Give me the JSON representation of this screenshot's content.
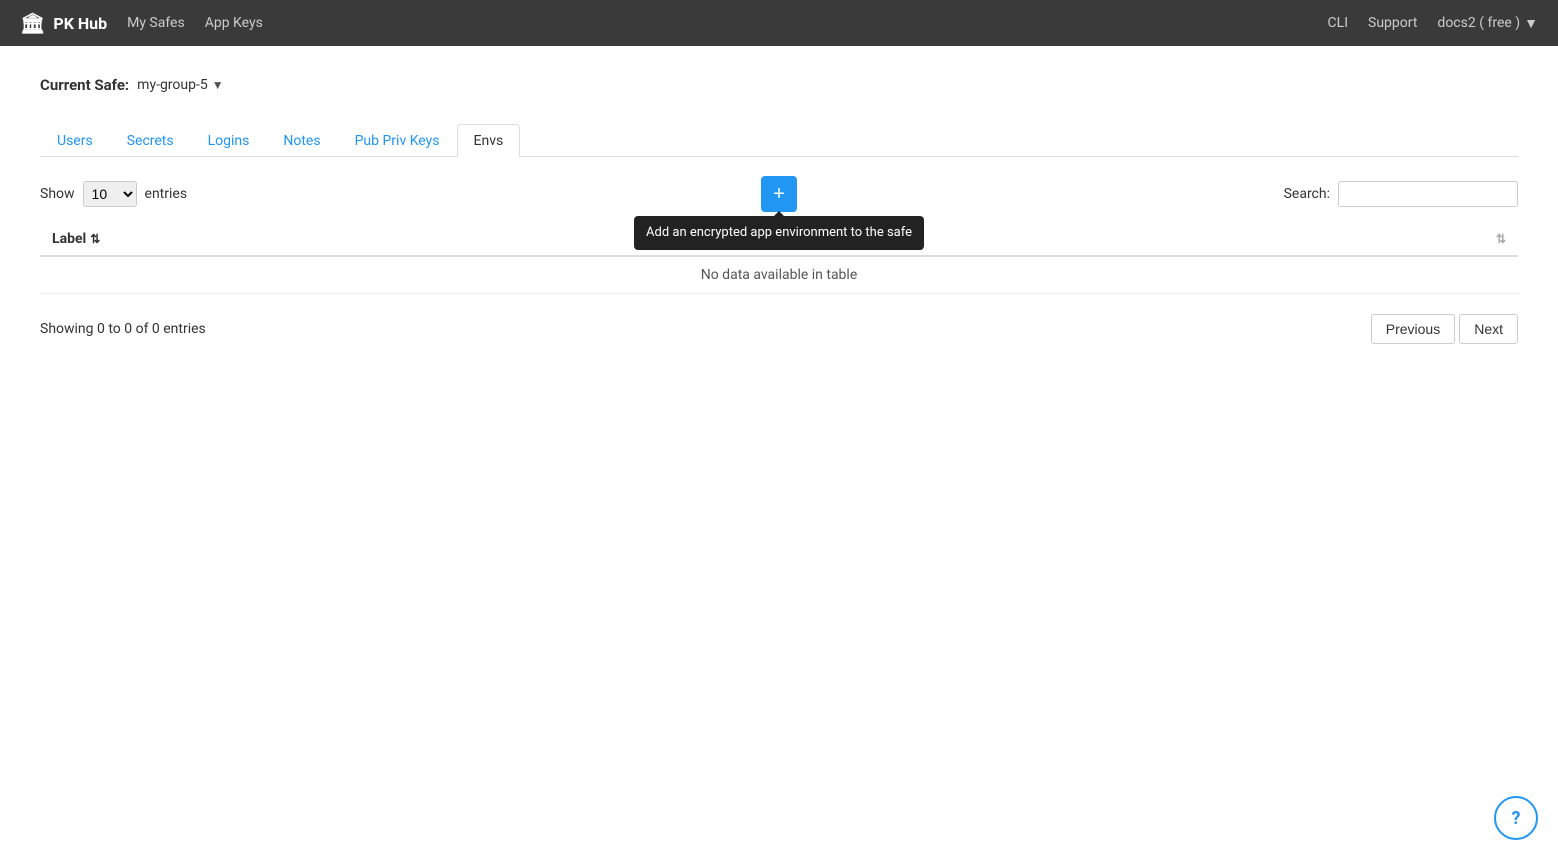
{
  "navbar": {
    "brand": "PK Hub",
    "vault_icon": "🏛",
    "links": [
      {
        "label": "My Safes",
        "href": "#"
      },
      {
        "label": "App Keys",
        "href": "#"
      }
    ],
    "right_links": [
      {
        "label": "CLI",
        "href": "#"
      },
      {
        "label": "Support",
        "href": "#"
      },
      {
        "label": "docs2 ( free )",
        "href": "#",
        "dropdown": true
      }
    ]
  },
  "current_safe": {
    "label": "Current Safe:",
    "value": "my-group-5"
  },
  "tabs": [
    {
      "label": "Users",
      "active": false
    },
    {
      "label": "Secrets",
      "active": false
    },
    {
      "label": "Logins",
      "active": false
    },
    {
      "label": "Notes",
      "active": false
    },
    {
      "label": "Pub Priv Keys",
      "active": false
    },
    {
      "label": "Envs",
      "active": true
    }
  ],
  "table_controls": {
    "show_label": "Show",
    "entries_label": "entries",
    "entries_value": "10",
    "search_label": "Search:",
    "search_placeholder": "",
    "add_button_tooltip": "Add an encrypted app environment to the safe"
  },
  "table": {
    "columns": [
      {
        "label": "Label",
        "sortable": true,
        "sort_state": "asc"
      },
      {
        "label": "",
        "sortable": true,
        "sort_state": "none"
      }
    ],
    "no_data_text": "No data available in table"
  },
  "pagination": {
    "info": "Showing 0 to 0 of 0 entries",
    "previous_label": "Previous",
    "next_label": "Next"
  },
  "help": {
    "icon": "?"
  }
}
